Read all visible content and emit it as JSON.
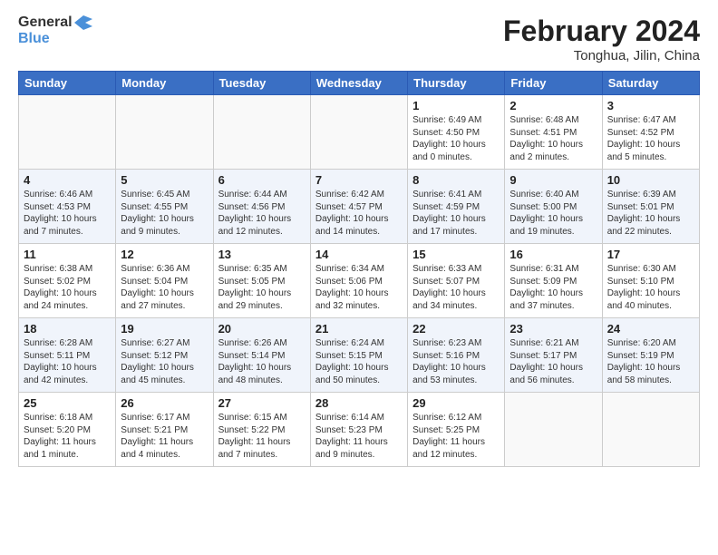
{
  "logo": {
    "line1": "General",
    "line2": "Blue"
  },
  "title": "February 2024",
  "subtitle": "Tonghua, Jilin, China",
  "weekdays": [
    "Sunday",
    "Monday",
    "Tuesday",
    "Wednesday",
    "Thursday",
    "Friday",
    "Saturday"
  ],
  "weeks": [
    [
      {
        "day": "",
        "info": ""
      },
      {
        "day": "",
        "info": ""
      },
      {
        "day": "",
        "info": ""
      },
      {
        "day": "",
        "info": ""
      },
      {
        "day": "1",
        "info": "Sunrise: 6:49 AM\nSunset: 4:50 PM\nDaylight: 10 hours\nand 0 minutes."
      },
      {
        "day": "2",
        "info": "Sunrise: 6:48 AM\nSunset: 4:51 PM\nDaylight: 10 hours\nand 2 minutes."
      },
      {
        "day": "3",
        "info": "Sunrise: 6:47 AM\nSunset: 4:52 PM\nDaylight: 10 hours\nand 5 minutes."
      }
    ],
    [
      {
        "day": "4",
        "info": "Sunrise: 6:46 AM\nSunset: 4:53 PM\nDaylight: 10 hours\nand 7 minutes."
      },
      {
        "day": "5",
        "info": "Sunrise: 6:45 AM\nSunset: 4:55 PM\nDaylight: 10 hours\nand 9 minutes."
      },
      {
        "day": "6",
        "info": "Sunrise: 6:44 AM\nSunset: 4:56 PM\nDaylight: 10 hours\nand 12 minutes."
      },
      {
        "day": "7",
        "info": "Sunrise: 6:42 AM\nSunset: 4:57 PM\nDaylight: 10 hours\nand 14 minutes."
      },
      {
        "day": "8",
        "info": "Sunrise: 6:41 AM\nSunset: 4:59 PM\nDaylight: 10 hours\nand 17 minutes."
      },
      {
        "day": "9",
        "info": "Sunrise: 6:40 AM\nSunset: 5:00 PM\nDaylight: 10 hours\nand 19 minutes."
      },
      {
        "day": "10",
        "info": "Sunrise: 6:39 AM\nSunset: 5:01 PM\nDaylight: 10 hours\nand 22 minutes."
      }
    ],
    [
      {
        "day": "11",
        "info": "Sunrise: 6:38 AM\nSunset: 5:02 PM\nDaylight: 10 hours\nand 24 minutes."
      },
      {
        "day": "12",
        "info": "Sunrise: 6:36 AM\nSunset: 5:04 PM\nDaylight: 10 hours\nand 27 minutes."
      },
      {
        "day": "13",
        "info": "Sunrise: 6:35 AM\nSunset: 5:05 PM\nDaylight: 10 hours\nand 29 minutes."
      },
      {
        "day": "14",
        "info": "Sunrise: 6:34 AM\nSunset: 5:06 PM\nDaylight: 10 hours\nand 32 minutes."
      },
      {
        "day": "15",
        "info": "Sunrise: 6:33 AM\nSunset: 5:07 PM\nDaylight: 10 hours\nand 34 minutes."
      },
      {
        "day": "16",
        "info": "Sunrise: 6:31 AM\nSunset: 5:09 PM\nDaylight: 10 hours\nand 37 minutes."
      },
      {
        "day": "17",
        "info": "Sunrise: 6:30 AM\nSunset: 5:10 PM\nDaylight: 10 hours\nand 40 minutes."
      }
    ],
    [
      {
        "day": "18",
        "info": "Sunrise: 6:28 AM\nSunset: 5:11 PM\nDaylight: 10 hours\nand 42 minutes."
      },
      {
        "day": "19",
        "info": "Sunrise: 6:27 AM\nSunset: 5:12 PM\nDaylight: 10 hours\nand 45 minutes."
      },
      {
        "day": "20",
        "info": "Sunrise: 6:26 AM\nSunset: 5:14 PM\nDaylight: 10 hours\nand 48 minutes."
      },
      {
        "day": "21",
        "info": "Sunrise: 6:24 AM\nSunset: 5:15 PM\nDaylight: 10 hours\nand 50 minutes."
      },
      {
        "day": "22",
        "info": "Sunrise: 6:23 AM\nSunset: 5:16 PM\nDaylight: 10 hours\nand 53 minutes."
      },
      {
        "day": "23",
        "info": "Sunrise: 6:21 AM\nSunset: 5:17 PM\nDaylight: 10 hours\nand 56 minutes."
      },
      {
        "day": "24",
        "info": "Sunrise: 6:20 AM\nSunset: 5:19 PM\nDaylight: 10 hours\nand 58 minutes."
      }
    ],
    [
      {
        "day": "25",
        "info": "Sunrise: 6:18 AM\nSunset: 5:20 PM\nDaylight: 11 hours\nand 1 minute."
      },
      {
        "day": "26",
        "info": "Sunrise: 6:17 AM\nSunset: 5:21 PM\nDaylight: 11 hours\nand 4 minutes."
      },
      {
        "day": "27",
        "info": "Sunrise: 6:15 AM\nSunset: 5:22 PM\nDaylight: 11 hours\nand 7 minutes."
      },
      {
        "day": "28",
        "info": "Sunrise: 6:14 AM\nSunset: 5:23 PM\nDaylight: 11 hours\nand 9 minutes."
      },
      {
        "day": "29",
        "info": "Sunrise: 6:12 AM\nSunset: 5:25 PM\nDaylight: 11 hours\nand 12 minutes."
      },
      {
        "day": "",
        "info": ""
      },
      {
        "day": "",
        "info": ""
      }
    ]
  ]
}
